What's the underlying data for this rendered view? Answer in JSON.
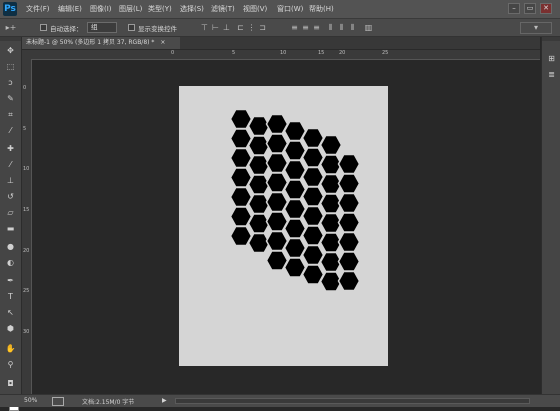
{
  "app": {
    "logo": "Ps"
  },
  "menu": [
    "文件(F)",
    "编辑(E)",
    "图像(I)",
    "图层(L)",
    "类型(Y)",
    "选择(S)",
    "滤镜(T)",
    "视图(V)",
    "窗口(W)",
    "帮助(H)"
  ],
  "window_controls": {
    "minimize": "–",
    "restore": "▭",
    "close": "✕"
  },
  "options": {
    "auto_select_label": "自动选择：",
    "auto_select_value": "组",
    "show_transform_label": "显示变换控件"
  },
  "document": {
    "tab_title": "未标题-1 @ 50% (多边形 1 拷贝 37, RGB/8) *",
    "tab_close": "×"
  },
  "ruler": {
    "top": [
      "0",
      "5",
      "10",
      "15",
      "20",
      "25"
    ],
    "left": [
      "0",
      "5",
      "10",
      "15",
      "20",
      "25",
      "30"
    ]
  },
  "tools": [
    {
      "icon": "move-icon",
      "glyph": "✥"
    },
    {
      "icon": "marquee-icon",
      "glyph": "⬚"
    },
    {
      "icon": "lasso-icon",
      "glyph": "ↄ"
    },
    {
      "icon": "quick-select-icon",
      "glyph": "✎"
    },
    {
      "icon": "crop-icon",
      "glyph": "⌗"
    },
    {
      "icon": "eyedropper-icon",
      "glyph": "⁄"
    },
    {
      "icon": "healing-icon",
      "glyph": "✚"
    },
    {
      "icon": "brush-icon",
      "glyph": "⁄"
    },
    {
      "icon": "stamp-icon",
      "glyph": "⊥"
    },
    {
      "icon": "history-brush-icon",
      "glyph": "↺"
    },
    {
      "icon": "eraser-icon",
      "glyph": "▱"
    },
    {
      "icon": "gradient-icon",
      "glyph": "▬"
    },
    {
      "icon": "blur-icon",
      "glyph": "●"
    },
    {
      "icon": "dodge-icon",
      "glyph": "◐"
    },
    {
      "icon": "pen-icon",
      "glyph": "✒"
    },
    {
      "icon": "type-icon",
      "glyph": "T"
    },
    {
      "icon": "path-select-icon",
      "glyph": "↖"
    },
    {
      "icon": "shape-icon",
      "glyph": "⬢"
    },
    {
      "icon": "hand-icon",
      "glyph": "✋"
    },
    {
      "icon": "zoom-icon",
      "glyph": "⚲"
    }
  ],
  "right_panel": [
    {
      "icon": "history-panel-icon",
      "glyph": "⊞"
    },
    {
      "icon": "adjust-panel-icon",
      "glyph": "≣"
    }
  ],
  "status": {
    "zoom": "50%",
    "doc_size": "文档:2.15M/0 字节",
    "arrow": "▶"
  },
  "colors": {
    "foreground": "#000000",
    "background": "#ffffff",
    "canvas_bg": "#d5d5d5",
    "workspace": "#282828"
  }
}
